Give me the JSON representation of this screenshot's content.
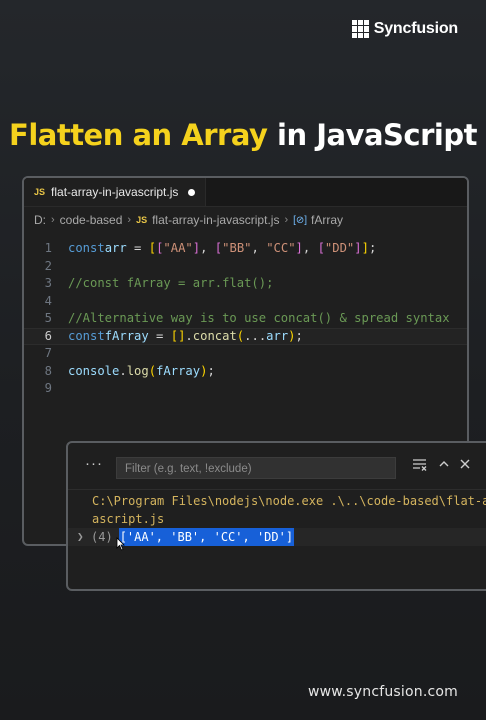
{
  "brand": {
    "logo_text": "Syncfusion",
    "url": "www.syncfusion.com"
  },
  "headline": {
    "highlight": "Flatten an Array",
    "rest": " in JavaScript",
    "highlight_color": "#f5d21d"
  },
  "editor": {
    "tab": {
      "badge": "JS",
      "label": "flat-array-in-javascript.js"
    },
    "breadcrumb": {
      "drive": "D:",
      "folder": "code-based",
      "file_badge": "JS",
      "file": "flat-array-in-javascript.js",
      "symbol": "fArray"
    },
    "current_line": 6,
    "lines": [
      {
        "n": "1"
      },
      {
        "n": "2"
      },
      {
        "n": "3"
      },
      {
        "n": "4"
      },
      {
        "n": "5"
      },
      {
        "n": "6"
      },
      {
        "n": "7"
      },
      {
        "n": "8"
      },
      {
        "n": "9"
      }
    ],
    "tokens": {
      "l1": [
        "const",
        "arr",
        " = ",
        "[",
        "[",
        "\"AA\"",
        "]",
        ", ",
        "[",
        "\"BB\"",
        ", ",
        "\"CC\"",
        "]",
        ", ",
        "[",
        "\"DD\"",
        "]",
        "]",
        ";"
      ],
      "l3": "//const fArray = arr.flat();",
      "l5": "//Alternative way is to use concat() & spread syntax",
      "l6": [
        "const",
        "fArray",
        " = ",
        "[",
        "]",
        ".",
        "concat",
        "(",
        "...",
        "arr",
        ")",
        ";"
      ],
      "l8": [
        "console",
        ".",
        "log",
        "(",
        "fArray",
        ")",
        ";"
      ]
    }
  },
  "console": {
    "more": "···",
    "filter_placeholder": "Filter (e.g. text, !exclude)",
    "command_line1": "C:\\Program Files\\nodejs\\node.exe .\\..\\code-based\\flat-a",
    "command_line2": "ascript.js",
    "result_count": "(4)",
    "result_value": "['AA', 'BB', 'CC', 'DD']"
  }
}
